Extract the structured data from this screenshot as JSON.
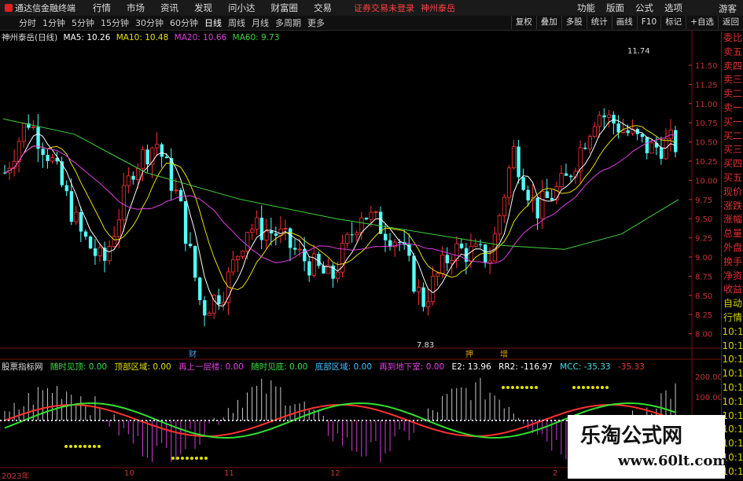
{
  "menubar": {
    "app_title": "通达信金融终端",
    "items": [
      "行情",
      "市场",
      "资讯",
      "发现",
      "问小达",
      "财富圈",
      "交易"
    ],
    "alert1": "证券交易未登录",
    "alert2": "神州泰岳",
    "right_items": [
      "功能",
      "版面",
      "公式",
      "选项"
    ],
    "guest": "游客"
  },
  "tabbar": {
    "tabs": [
      "分时",
      "1分钟",
      "5分钟",
      "15分钟",
      "30分钟",
      "60分钟",
      "日线",
      "周线",
      "月线",
      "多周期",
      "更多"
    ],
    "active": "日线",
    "right_tabs": [
      "复权",
      "叠加",
      "多股",
      "统计",
      "画线",
      "F10",
      "标记",
      "+自选",
      "返回"
    ]
  },
  "legend": {
    "title": "神州泰岳(日线)",
    "ma5": "MA5: 10.26",
    "ma10": "MA10: 10.48",
    "ma20": "MA20: 10.66",
    "ma60": "MA60: 9.73",
    "colors": {
      "ma5": "#ffffff",
      "ma10": "#e8e000",
      "ma20": "#e040e0",
      "ma60": "#40d040"
    }
  },
  "price_axis": [
    "11.50",
    "11.25",
    "11.00",
    "10.75",
    "10.50",
    "10.25",
    "10.00",
    "9.75",
    "9.50",
    "9.25",
    "9.00",
    "8.75",
    "8.50",
    "8.25",
    "8.00"
  ],
  "annotations": {
    "high": "11.74",
    "low": "7.83",
    "marker_cai": "财",
    "marker_zeng": "增",
    "marker_ya": "押"
  },
  "side_panel": [
    "委比",
    "卖五",
    "卖四",
    "卖三",
    "卖二",
    "卖一",
    "买一",
    "买二",
    "买三",
    "买四",
    "买五",
    "现价",
    "涨跌",
    "涨幅",
    "总量",
    "外盘",
    "换手",
    "净资",
    "收益",
    "自动",
    "行情",
    "10:1",
    "10:1",
    "10:1",
    "10:1",
    "10:1",
    "10:1",
    "10:1",
    "10:1",
    "10:1",
    "10:1",
    "10:1"
  ],
  "indicator": {
    "name": "股票指标网",
    "items": [
      {
        "label": "随时见顶: 0.00",
        "color": "#40e040"
      },
      {
        "label": "顶部区域: 0.00",
        "color": "#e0e000"
      },
      {
        "label": "再上一层楼: 0.00",
        "color": "#e040e0"
      },
      {
        "label": "随时见底: 0.00",
        "color": "#40e040"
      },
      {
        "label": "底部区域: 0.00",
        "color": "#40c0ff"
      },
      {
        "label": "再到地下室: 0.00",
        "color": "#e040e0"
      },
      {
        "label": "E2: 13.96",
        "color": "#ffffff"
      },
      {
        "label": "RR2: -116.97",
        "color": "#ffffff"
      },
      {
        "label": "MCC: -35.33",
        "color": "#40e0e0"
      },
      {
        "label": "-35.33",
        "color": "#e04040"
      }
    ],
    "axis": [
      "200.00",
      "100.00"
    ]
  },
  "time_axis": [
    "2023年",
    "10",
    "11",
    "12",
    "2"
  ],
  "watermark": {
    "line1": "乐淘公式网",
    "line2": "www.60lt.com"
  }
}
